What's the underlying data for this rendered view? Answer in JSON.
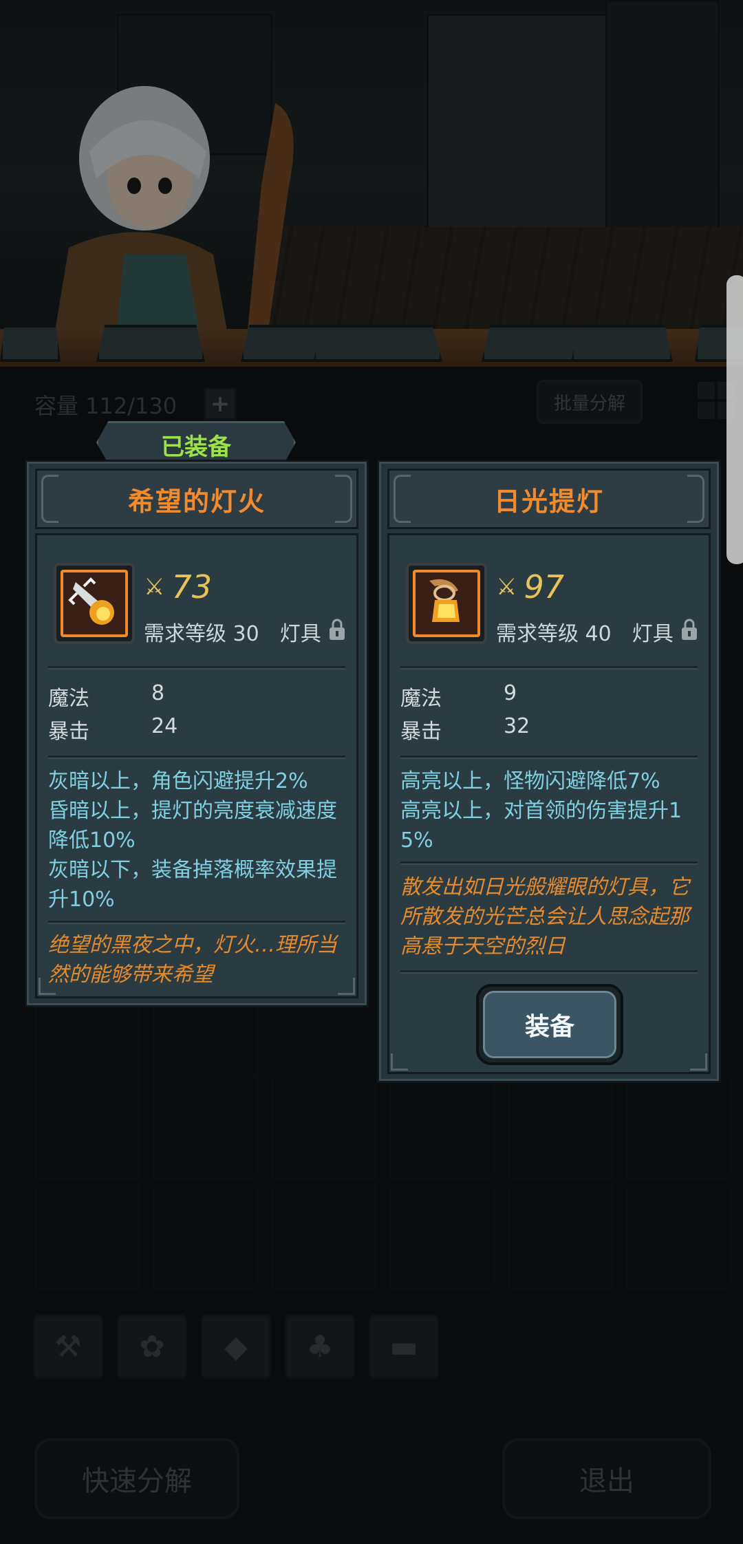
{
  "bag": {
    "capacity_label": "容量 112/130",
    "add_icon": "plus-icon",
    "batch_decompose_label": "批量分解",
    "grid_view_icon": "grid-icon",
    "filter_icons": [
      "weapon-icon",
      "paw-icon",
      "gem-icon",
      "leaf-icon",
      "chest-icon"
    ],
    "quick_decompose_label": "快速分解",
    "exit_label": "退出"
  },
  "equipped_card": {
    "tag": "已装备",
    "name": "希望的灯火",
    "power": "73",
    "level_req": "需求等级 30",
    "type": "灯具",
    "stats": [
      {
        "label": "魔法",
        "value": "8"
      },
      {
        "label": "暴击",
        "value": "24"
      }
    ],
    "effects": "灰暗以上，角色闪避提升2%\n昏暗以上，提灯的亮度衰减速度降低10%\n灰暗以下，装备掉落概率效果提升10%",
    "flavor": "绝望的黑夜之中，灯火…理所当然的能够带来希望"
  },
  "new_card": {
    "name": "日光提灯",
    "power": "97",
    "level_req": "需求等级 40",
    "type": "灯具",
    "stats": [
      {
        "label": "魔法",
        "value": "9"
      },
      {
        "label": "暴击",
        "value": "32"
      }
    ],
    "effects": "高亮以上，怪物闪避降低7%\n高亮以上，对首领的伤害提升15%",
    "flavor": "散发出如日光般耀眼的灯具，它所散发的光芒总会让人思念起那高悬于天空的烈日",
    "equip_button": "装备"
  },
  "colors": {
    "item_name": "#f28a2e",
    "power": "#e8c35a",
    "effect_text": "#7fd0e0",
    "flavor_text": "#e58a2d",
    "equipped_tag": "#9ee24a"
  }
}
